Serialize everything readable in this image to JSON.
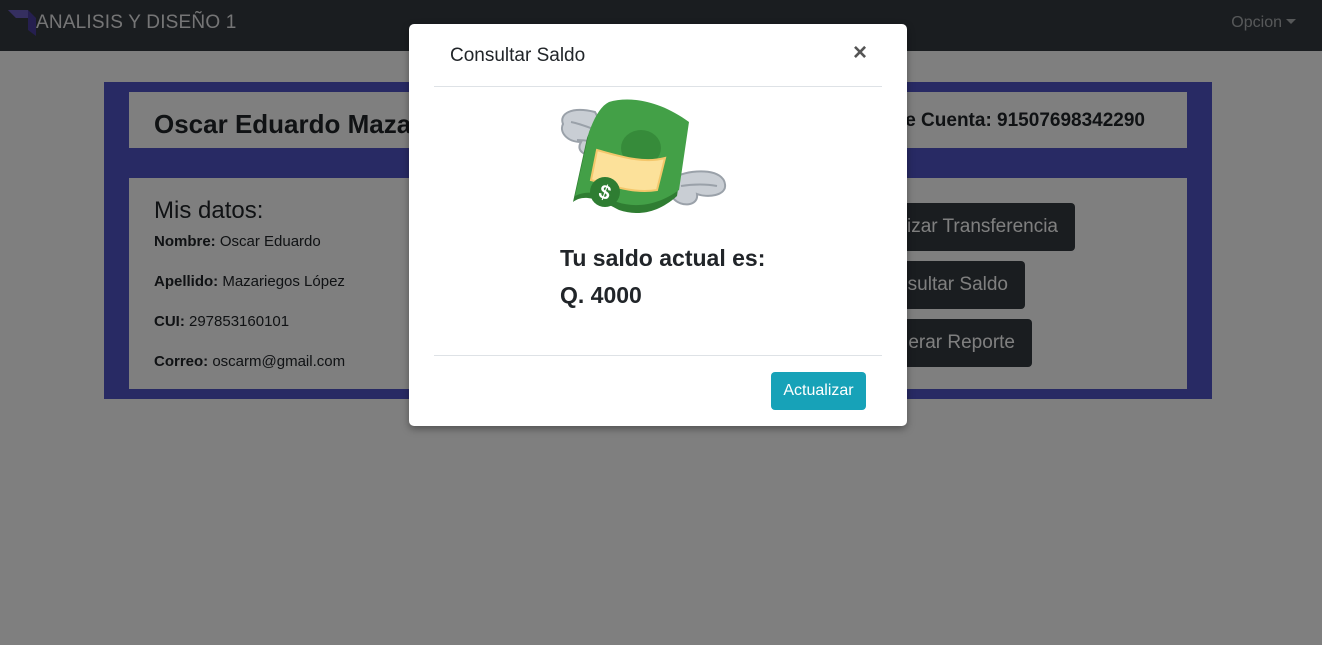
{
  "navbar": {
    "brand": "ANALISIS Y DISEÑO 1",
    "dropdown_label": "Opcion"
  },
  "profile": {
    "name": "Oscar Eduardo Maza",
    "account": "e Cuenta: 91507698342290"
  },
  "datos": {
    "title": "Mis datos:",
    "fields": [
      {
        "label": "Nombre:",
        "value": " Oscar Eduardo"
      },
      {
        "label": "Apellido:",
        "value": " Mazariegos López"
      },
      {
        "label": "CUI:",
        "value": " 297853160101"
      },
      {
        "label": "Correo:",
        "value": " oscarm@gmail.com"
      }
    ]
  },
  "actions": {
    "transfer": "izar Transferencia",
    "saldo": "sultar Saldo",
    "reporte": "erar Reporte"
  },
  "modal": {
    "title": "Consultar Saldo",
    "close": "×",
    "saldo_label": "Tu saldo actual es:",
    "saldo_value": "Q. 4000",
    "update_button": "Actualizar"
  },
  "colors": {
    "navbar": "#343a40",
    "panel": "#5154c9",
    "info_button": "#17a2b8",
    "dark_button": "#343a40"
  },
  "icons": {
    "brand": "brand-logo-icon",
    "money": "money-with-wings-icon"
  }
}
